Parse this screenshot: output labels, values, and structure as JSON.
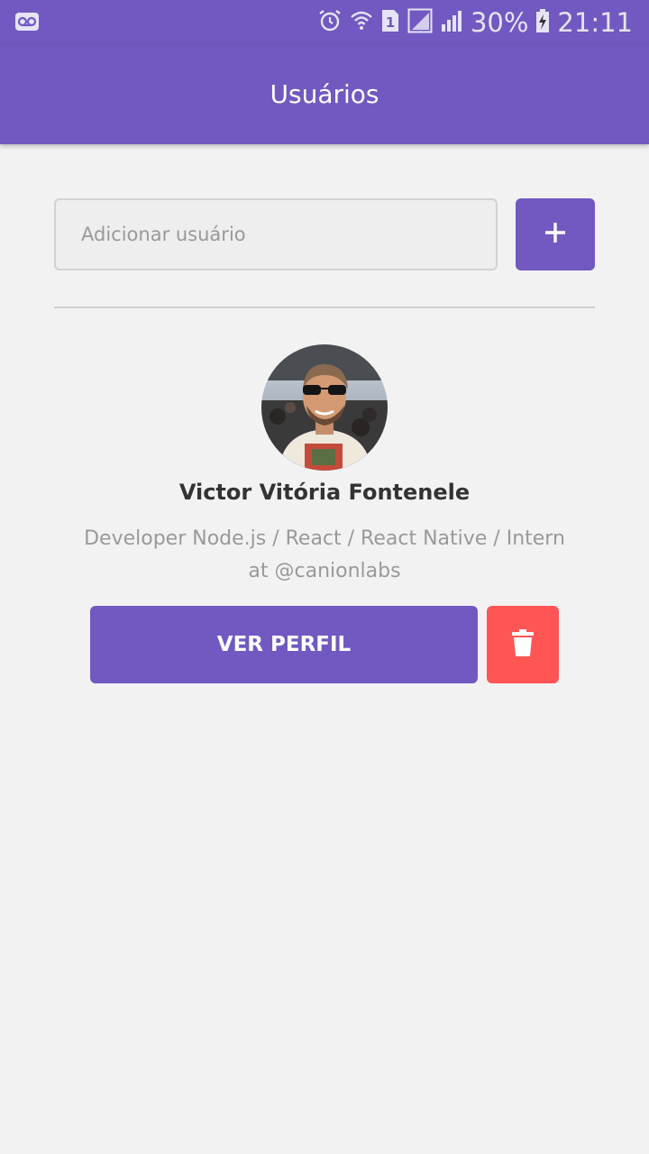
{
  "status_bar": {
    "battery_percent": "30%",
    "time": "21:11",
    "sim_slot": "1",
    "icons": [
      "voicemail-icon",
      "alarm-icon",
      "wifi-icon",
      "sim-1-icon",
      "signal-icon",
      "signal-icon",
      "battery-charging-icon"
    ]
  },
  "header": {
    "title": "Usuários"
  },
  "form": {
    "input_value": "",
    "input_placeholder": "Adicionar usuário",
    "add_button_icon": "plus-icon"
  },
  "users": [
    {
      "name": "Victor Vitória Fontenele",
      "bio": "Developer Node.js / React / React Native / Intern at @canionlabs",
      "profile_button_label": "VER PERFIL",
      "delete_button_icon": "trash-icon"
    }
  ],
  "colors": {
    "primary": "#7159c1",
    "danger": "#ff5555",
    "background": "#f2f2f2",
    "text_dark": "#333333",
    "text_muted": "#999999"
  }
}
